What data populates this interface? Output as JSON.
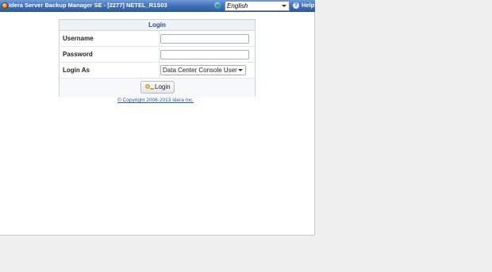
{
  "header": {
    "title": "Idera Server Backup Manager SE - [2277] NETEL_R1S03",
    "language": "English",
    "help_label": "Help"
  },
  "login": {
    "panel_title": "Login",
    "username_label": "Username",
    "username_value": "",
    "password_label": "Password",
    "password_value": "",
    "login_as_label": "Login As",
    "login_as_value": "Data Center Console User",
    "button_label": "Login"
  },
  "footer": {
    "copyright": "© Copyright 2006-2013 Idera Inc."
  },
  "icons": [
    "app-logo-icon",
    "globe-icon",
    "chevron-down-icon",
    "help-icon",
    "key-icon"
  ]
}
